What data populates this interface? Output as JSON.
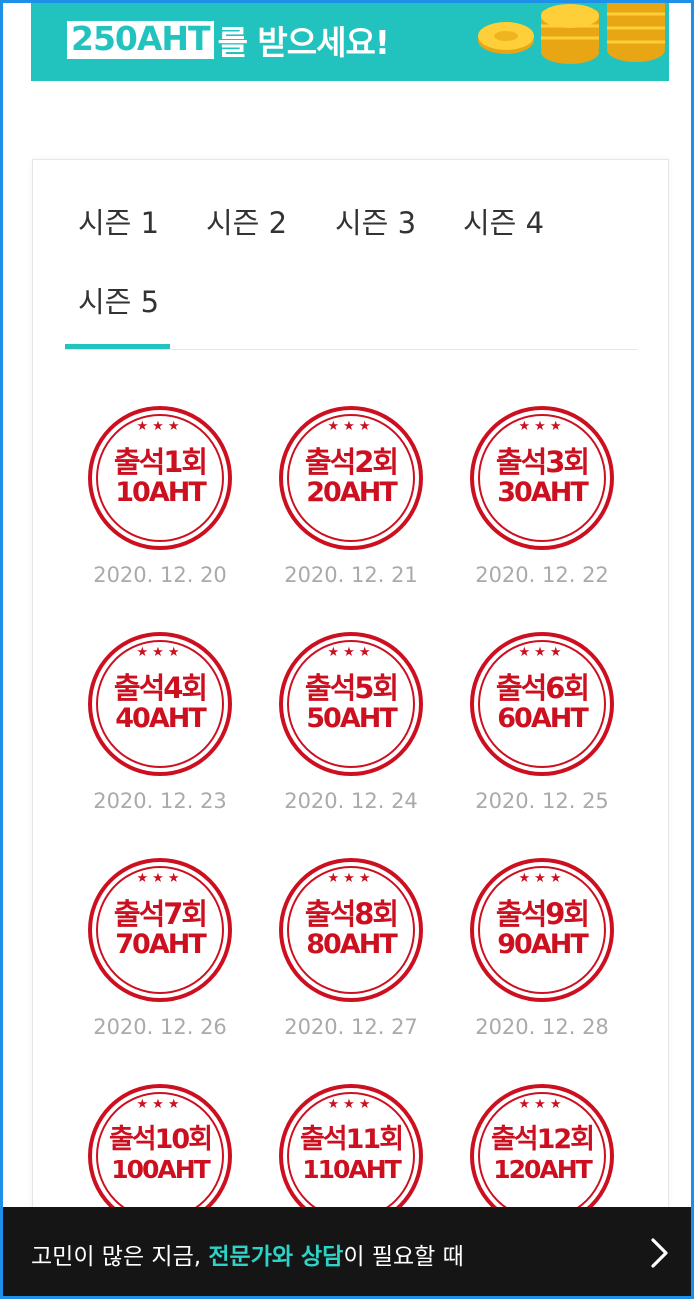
{
  "banner": {
    "amount": "250AHT",
    "suffix": "를 받으세요!",
    "background": "#22c3bf"
  },
  "tabs": [
    {
      "label": "시즌 1",
      "active": false
    },
    {
      "label": "시즌 2",
      "active": false
    },
    {
      "label": "시즌 3",
      "active": false
    },
    {
      "label": "시즌 4",
      "active": false
    },
    {
      "label": "시즌 5",
      "active": true
    }
  ],
  "stamps": [
    {
      "title": "출석1회",
      "reward": "10AHT",
      "date": "2020. 12. 20"
    },
    {
      "title": "출석2회",
      "reward": "20AHT",
      "date": "2020. 12. 21"
    },
    {
      "title": "출석3회",
      "reward": "30AHT",
      "date": "2020. 12. 22"
    },
    {
      "title": "출석4회",
      "reward": "40AHT",
      "date": "2020. 12. 23"
    },
    {
      "title": "출석5회",
      "reward": "50AHT",
      "date": "2020. 12. 24"
    },
    {
      "title": "출석6회",
      "reward": "60AHT",
      "date": "2020. 12. 25"
    },
    {
      "title": "출석7회",
      "reward": "70AHT",
      "date": "2020. 12. 26"
    },
    {
      "title": "출석8회",
      "reward": "80AHT",
      "date": "2020. 12. 27"
    },
    {
      "title": "출석9회",
      "reward": "90AHT",
      "date": "2020. 12. 28"
    },
    {
      "title": "출석10회",
      "reward": "100AHT",
      "date": ""
    },
    {
      "title": "출석11회",
      "reward": "110AHT",
      "date": ""
    },
    {
      "title": "출석12회",
      "reward": "120AHT",
      "date": ""
    }
  ],
  "stamp_stars": "★★★",
  "bottom_bar": {
    "prefix": "고민이 많은 지금, ",
    "highlight": "전문가와 상담",
    "suffix": "이 필요할 때",
    "icon": "chevron-right-icon"
  },
  "colors": {
    "accent": "#22c3bf",
    "stamp_red": "#cc1020",
    "date_gray": "#aaaaaa"
  }
}
